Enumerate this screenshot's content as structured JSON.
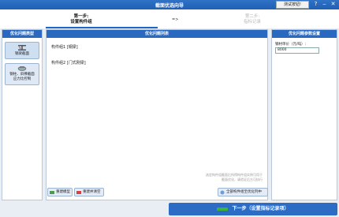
{
  "window": {
    "title": "截面优选向导",
    "test_button": "测试按钮!",
    "help": "?",
    "minimize": "‒",
    "close": "✕"
  },
  "steps": {
    "step1_number": "第一步:",
    "step1_label": "设置构件组",
    "arrow": "=>",
    "step2_number": "第二步:",
    "step2_label": "指标记录"
  },
  "left_panel": {
    "header": "优化问题类型",
    "types": [
      {
        "label": "钢梁截面"
      },
      {
        "label1": "钢柱、斜撑截面",
        "label2": "应力比控制"
      }
    ]
  },
  "middle_panel": {
    "header": "优化问题列表",
    "items": [
      "构件组1 [钢梁]",
      "构件组2 [门式刚梁]"
    ],
    "hint": "选定构件组截面后所得构件组实例可用于截面优化，请验证后方可执行",
    "buttons": {
      "del_model": "重建模型",
      "clear_records": "重建并清空",
      "all_to_optimization": "全部构件组至优化列中"
    }
  },
  "right_panel": {
    "header": "优化问题参数设置",
    "price_label": "钢材单价（元/吨）:",
    "price_value": "8000"
  },
  "footer": {
    "next_button": "下一步（设置指标记录项）"
  }
}
